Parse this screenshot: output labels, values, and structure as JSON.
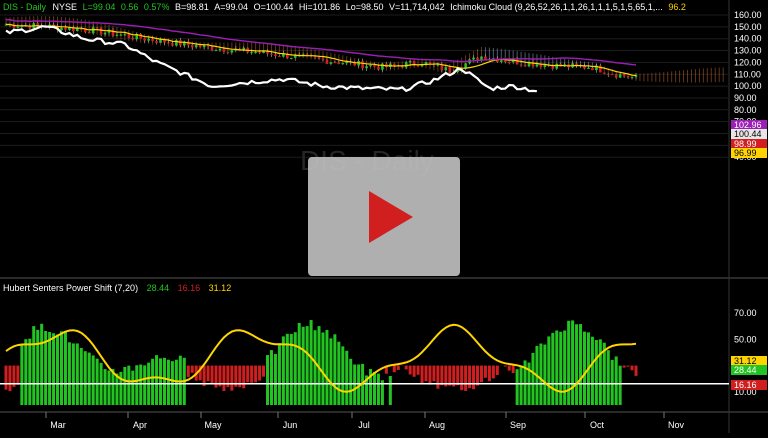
{
  "header": {
    "symbol": "DIS - Daily",
    "exchange": "NYSE",
    "last": "L=99.04",
    "change": "0.56",
    "change_pct": "0.57%",
    "bid": "B=98.81",
    "ask": "A=99.04",
    "open": "O=100.44",
    "high": "Hi=101.86",
    "low": "Lo=98.50",
    "volume": "V=11,714,042",
    "cloud_label": "Ichimoku Cloud (9,26,52,26,1,1,26,1,1,1,5,1,5,65,1,...",
    "cloud_value": "96.2"
  },
  "watermark": "DIS - Daily",
  "price_axis": {
    "ticks": [
      "160.00",
      "150.00",
      "140.00",
      "130.00",
      "120.00",
      "110.00",
      "100.00",
      "90.00",
      "80.00",
      "70.00",
      "60.00",
      "50.00",
      "40.00"
    ],
    "badges": [
      {
        "text": "102.96",
        "color": "#9b1fb5"
      },
      {
        "text": "100.44",
        "color": "#e6e6e6"
      },
      {
        "text": "98.99",
        "color": "#d11f1f"
      },
      {
        "text": "96.99",
        "color": "#ffd400"
      }
    ]
  },
  "indicator": {
    "label": "Hubert Senters Power Shift (7,20)",
    "value_green": "28.44",
    "value_red": "16.16",
    "value_yellow": "31.12",
    "ticks": [
      "70.00",
      "50.00",
      "30.00",
      "10.00"
    ],
    "badges": [
      {
        "text": "31.12",
        "color": "#ffd400"
      },
      {
        "text": "28.44",
        "color": "#22c422"
      },
      {
        "text": "16.16",
        "color": "#d11f1f"
      }
    ]
  },
  "months": [
    "Mar",
    "Apr",
    "May",
    "Jun",
    "Jul",
    "Aug",
    "Sep",
    "Oct",
    "Nov"
  ],
  "colors": {
    "green": "#22c422",
    "red": "#d11f1f",
    "yellow": "#ffd400",
    "purple": "#9b1fb5",
    "cloud_bear": "#b8622a",
    "cloud_bull": "#8fa3c8",
    "white": "#ffffff"
  },
  "play_icon": "play-icon"
}
